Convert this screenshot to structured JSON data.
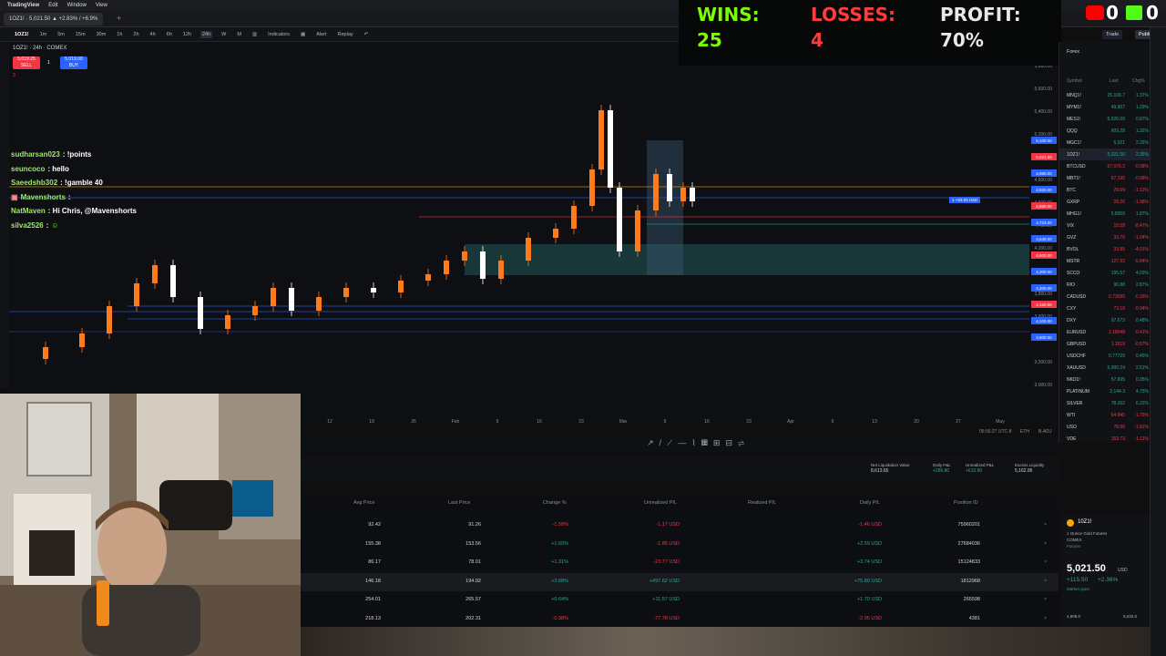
{
  "menubar": {
    "app": "TradingView",
    "items": [
      "Edit",
      "Window",
      "View"
    ]
  },
  "tabs": [
    {
      "label": "1OZ1! · 5,021.50 ▲ +2.83% / +6.9%",
      "active": true
    }
  ],
  "toolbar": {
    "symbol": "1OZ1!",
    "intervals": [
      "1m",
      "5m",
      "15m",
      "30m",
      "1h",
      "2h",
      "4h",
      "6h",
      "12h",
      "24h",
      "W",
      "M"
    ],
    "indicators": "Indicators",
    "alert": "Alert",
    "replay": "Replay",
    "trade": "Trade",
    "publish": "Publish"
  },
  "chart": {
    "title": "1OZ1! · 24h · COMEX",
    "sell_price": "5,019.25",
    "sell_label": "SELL",
    "qty": "1",
    "buy_price": "5,019.00",
    "buy_label": "BUY",
    "lots": "3",
    "price_axis": [
      "5,800.00",
      "5,600.00",
      "5,400.00",
      "5,200.00",
      "5,000.00",
      "4,800.00",
      "4,600.00",
      "4,400.00",
      "4,200.00",
      "4,000.00",
      "3,800.00",
      "3,600.00",
      "3,400.00",
      "3,200.00",
      "3,000.00"
    ],
    "time_axis": [
      "24",
      "Dec",
      "8",
      "15",
      "22",
      "2026",
      "5",
      "12",
      "19",
      "26",
      "Feb",
      "9",
      "16",
      "23",
      "Mar",
      "9",
      "16",
      "23",
      "Apr",
      "6",
      "13",
      "20",
      "27",
      "May"
    ],
    "time_readout": "05:56:27 UTC-8",
    "currency": "ETH",
    "adj": "B-ADJ",
    "price_tags": [
      "5,100.00",
      "5,021.50",
      "4,980.00",
      "4,920.00",
      "4,880.00",
      "4,723.00",
      "4,640.00",
      "4,600.00",
      "4,300.00",
      "4,200.00",
      "4,150.00",
      "4,100.00",
      "3,900.00"
    ],
    "chart_position_label": "1  +83.93 USD"
  },
  "scoreboard": {
    "wins_label": "WINS:",
    "wins_value": "25",
    "losses_label": "LOSSES:",
    "losses_value": "4",
    "profit_label": "PROFIT:",
    "profit_value": "70%",
    "yt_count": "0",
    "kick_count": "0"
  },
  "chat": [
    {
      "user": "sudharsan023",
      "msg": ": !points"
    },
    {
      "user": "seuncoco",
      "msg": ": hello"
    },
    {
      "user": "Saeedshb302",
      "msg": ": !gamble 40"
    },
    {
      "user": "Mavenshorts",
      "msg": ":"
    },
    {
      "user": "NatMaven",
      "msg": ": Hi Chris, @Mavenshorts"
    },
    {
      "user": "silva2526",
      "msg": ":"
    }
  ],
  "watchlist": {
    "header": "Forex",
    "cols": [
      "Symbol",
      "Last",
      "Chg%"
    ],
    "rows": [
      {
        "sym": "MNQ1!",
        "last": "25,106.7",
        "chg": "1.37%",
        "dir": "up"
      },
      {
        "sym": "MYM1!",
        "last": "49,907",
        "chg": "1.29%",
        "dir": "up"
      },
      {
        "sym": "MES1!",
        "last": "6,926.00",
        "chg": "0.87%",
        "dir": "up"
      },
      {
        "sym": "QQQ",
        "last": "609.28",
        "chg": "1.32%",
        "dir": "up"
      },
      {
        "sym": "MGC1!",
        "last": "5,021",
        "chg": "2.26%",
        "dir": "up"
      },
      {
        "sym": "1OZ1!",
        "last": "5,021.50",
        "chg": "2.35%",
        "dir": "up"
      },
      {
        "sym": "BTCUSD",
        "last": "67,076.3",
        "chg": "-0.08%",
        "dir": "down"
      },
      {
        "sym": "MBT1!",
        "last": "67,190",
        "chg": "-0.98%",
        "dir": "down"
      },
      {
        "sym": "BTC",
        "last": "29.69",
        "chg": "-1.12%",
        "dir": "down"
      },
      {
        "sym": "GXRP",
        "last": "28.26",
        "chg": "-1.98%",
        "dir": "down"
      },
      {
        "sym": "MHG1!",
        "last": "5.8050",
        "chg": "1.87%",
        "dir": "up"
      },
      {
        "sym": "VIX",
        "last": "18.58",
        "chg": "-8.47%",
        "dir": "down"
      },
      {
        "sym": "GVZ",
        "last": "33.70",
        "chg": "-1.04%",
        "dir": "down"
      },
      {
        "sym": "BVOL",
        "last": "33.85",
        "chg": "-4.01%",
        "dir": "down"
      },
      {
        "sym": "MSTR",
        "last": "127.93",
        "chg": "-5.84%",
        "dir": "down"
      },
      {
        "sym": "SCCO",
        "last": "195.57",
        "chg": "4.03%",
        "dir": "up"
      },
      {
        "sym": "RIO",
        "last": "96.88",
        "chg": "2.87%",
        "dir": "up"
      },
      {
        "sym": "CADUSD",
        "last": "0.73095",
        "chg": "-0.33%",
        "dir": "down"
      },
      {
        "sym": "CXY",
        "last": "73.10",
        "chg": "-0.34%",
        "dir": "down"
      },
      {
        "sym": "DXY",
        "last": "97.673",
        "chg": "0.48%",
        "dir": "up"
      },
      {
        "sym": "EURUSD",
        "last": "1.18048",
        "chg": "-0.41%",
        "dir": "down"
      },
      {
        "sym": "GBPUSD",
        "last": "1.3519",
        "chg": "-0.57%",
        "dir": "down"
      },
      {
        "sym": "USDCHF",
        "last": "0.77729",
        "chg": "0.45%",
        "dir": "up"
      },
      {
        "sym": "XAUUSD",
        "last": "5,000.24",
        "chg": "2.51%",
        "dir": "up"
      },
      {
        "sym": "NKD1!",
        "last": "57,695",
        "chg": "0.35%",
        "dir": "up"
      },
      {
        "sym": "PLATINUM",
        "last": "2,144.3",
        "chg": "4.75%",
        "dir": "up"
      },
      {
        "sym": "SILVER",
        "last": "78.262",
        "chg": "6.22%",
        "dir": "up"
      },
      {
        "sym": "WTI",
        "last": "64.845",
        "chg": "-1.79%",
        "dir": "down"
      },
      {
        "sym": "USO",
        "last": "78.95",
        "chg": "-1.81%",
        "dir": "down"
      },
      {
        "sym": "VDE",
        "last": "153.73",
        "chg": "-1.11%",
        "dir": "down"
      }
    ]
  },
  "account": {
    "labels": [
      "Net Liquidation Value",
      "Daily P&L",
      "Unrealized P&L",
      "Excess Liquidity"
    ],
    "values": [
      "8,613.65",
      "+286.80",
      "+610.90",
      "5,162.95"
    ]
  },
  "positions": {
    "headers": [
      "Avg Price",
      "Last Price",
      "Change %",
      "Unrealized P/L",
      "Realized P/L",
      "Daily P/L",
      "Position ID"
    ],
    "rows": [
      {
        "avg": "92.42",
        "last": "91.26",
        "chg": "-1.58%",
        "upl": "-1.17 USD",
        "dpl": "-1.46 USD",
        "id": "75960201",
        "dir": "down"
      },
      {
        "avg": "155.38",
        "last": "153.56",
        "chg": "+1.60%",
        "upl": "-1.85 USD",
        "dpl": "+2.59 USD",
        "id": "27684036",
        "dir": "down"
      },
      {
        "avg": "86.17",
        "last": "78.01",
        "chg": "+1.31%",
        "upl": "-23.77 USD",
        "dpl": "+3.74 USD",
        "id": "15124833",
        "dir": "down"
      },
      {
        "avg": "146.18",
        "last": "194.92",
        "chg": "+3.68%",
        "upl": "+497.62 USD",
        "dpl": "+75.80 USD",
        "id": "1812968",
        "dir": "up"
      },
      {
        "avg": "254.01",
        "last": "265.57",
        "chg": "+0.64%",
        "upl": "+11.57 USD",
        "dpl": "+1.70 USD",
        "id": "265598",
        "dir": "up"
      },
      {
        "avg": "218.13",
        "last": "202.31",
        "chg": "-0.38%",
        "upl": "-77.78 USD",
        "dpl": "-2.05 USD",
        "id": "4381",
        "dir": "down"
      }
    ]
  },
  "detail": {
    "symbol": "10Z1!",
    "desc": "1 Ounce Gold Futures",
    "exchange": "COMEX",
    "type": "Futures",
    "price": "5,021.50",
    "currency": "USD",
    "change": "+115.50",
    "change_pct": "+2.36%",
    "status": "Market open",
    "low": "4,808.0",
    "high": "5,032.0"
  },
  "colors": {
    "up": "#22ab94",
    "down": "#f23645",
    "accent": "#2962ff",
    "wins": "#7CFC00",
    "losses": "#ff3b3b",
    "profit": "#e8e8e8"
  }
}
